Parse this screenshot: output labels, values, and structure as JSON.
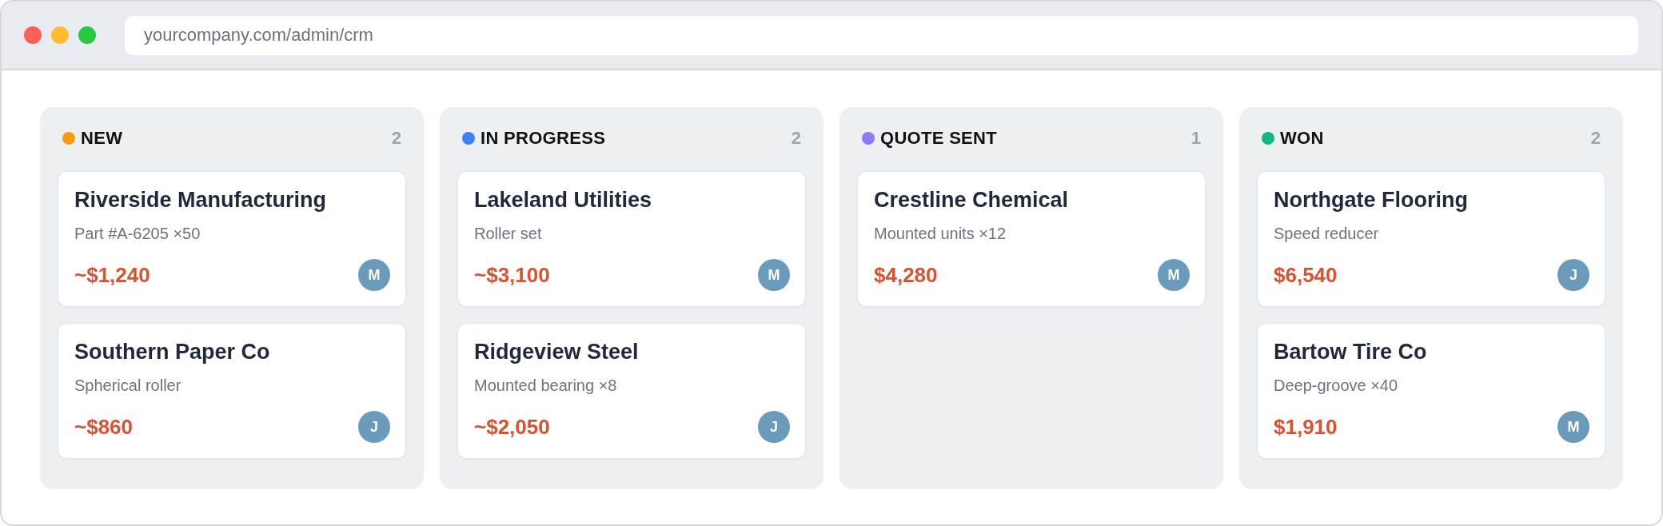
{
  "window": {
    "url": "yourcompany.com/admin/crm"
  },
  "columns": [
    {
      "title": "NEW",
      "color": "#f59e0b",
      "count": "2",
      "cards": [
        {
          "company": "Riverside Manufacturing",
          "item": "Part #A-6205 ×50",
          "amount": "~$1,240",
          "owner": "M"
        },
        {
          "company": "Southern Paper Co",
          "item": "Spherical roller",
          "amount": "~$860",
          "owner": "J"
        }
      ]
    },
    {
      "title": "IN PROGRESS",
      "color": "#3b82f6",
      "count": "2",
      "cards": [
        {
          "company": "Lakeland Utilities",
          "item": "Roller set",
          "amount": "~$3,100",
          "owner": "M"
        },
        {
          "company": "Ridgeview Steel",
          "item": "Mounted bearing ×8",
          "amount": "~$2,050",
          "owner": "J"
        }
      ]
    },
    {
      "title": "QUOTE SENT",
      "color": "#8b7cf6",
      "count": "1",
      "cards": [
        {
          "company": "Crestline Chemical",
          "item": "Mounted units ×12",
          "amount": "$4,280",
          "owner": "M"
        }
      ]
    },
    {
      "title": "WON",
      "color": "#10b981",
      "count": "2",
      "cards": [
        {
          "company": "Northgate Flooring",
          "item": "Speed reducer",
          "amount": "$6,540",
          "owner": "J"
        },
        {
          "company": "Bartow Tire Co",
          "item": "Deep-groove ×40",
          "amount": "$1,910",
          "owner": "M"
        }
      ]
    }
  ]
}
